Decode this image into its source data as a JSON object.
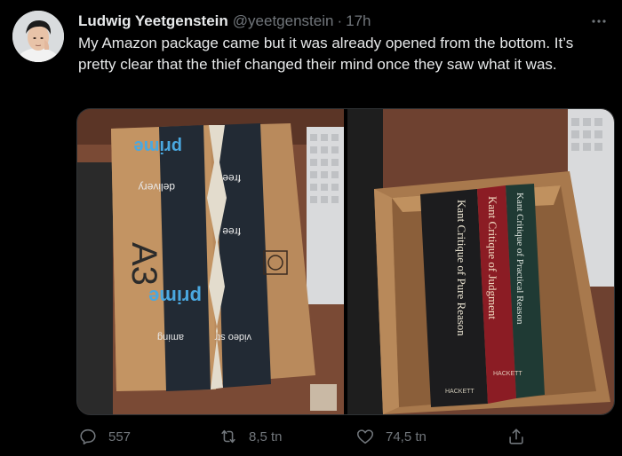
{
  "tweet": {
    "display_name": "Ludwig Yeetgenstein",
    "handle": "@yeetgenstein",
    "separator": "·",
    "time": "17h",
    "text": "My Amazon package came but it was already opened from the bottom. It’s pretty clear that the thief changed their mind once they saw what it was.",
    "avatar_icon": "avatar-photo",
    "more_icon": "more-icon"
  },
  "media": {
    "photo_1": {
      "label_prime_top": "prime",
      "label_delivery": "delivery",
      "label_free_top": "free",
      "label_free_2": "free",
      "label_prime_bottom": "prime",
      "label_video": "video str",
      "label_gaming": "aming",
      "label_a3": "A3"
    },
    "photo_2": {
      "book_1_spine": "Kant   Critique of Pure Reason",
      "book_2_spine": "Kant   Critique of Judgment",
      "book_3_spine": "Kant   Critique of Practical Reason",
      "publisher_1": "HACKETT",
      "publisher_2": "HACKETT"
    }
  },
  "actions": {
    "reply_count": "557",
    "retweet_count": "8,5 tn",
    "like_count": "74,5 tn",
    "share_label": ""
  },
  "colors": {
    "background": "#000000",
    "text": "#e7e9ea",
    "muted": "#71767b",
    "border": "#2f3336"
  }
}
